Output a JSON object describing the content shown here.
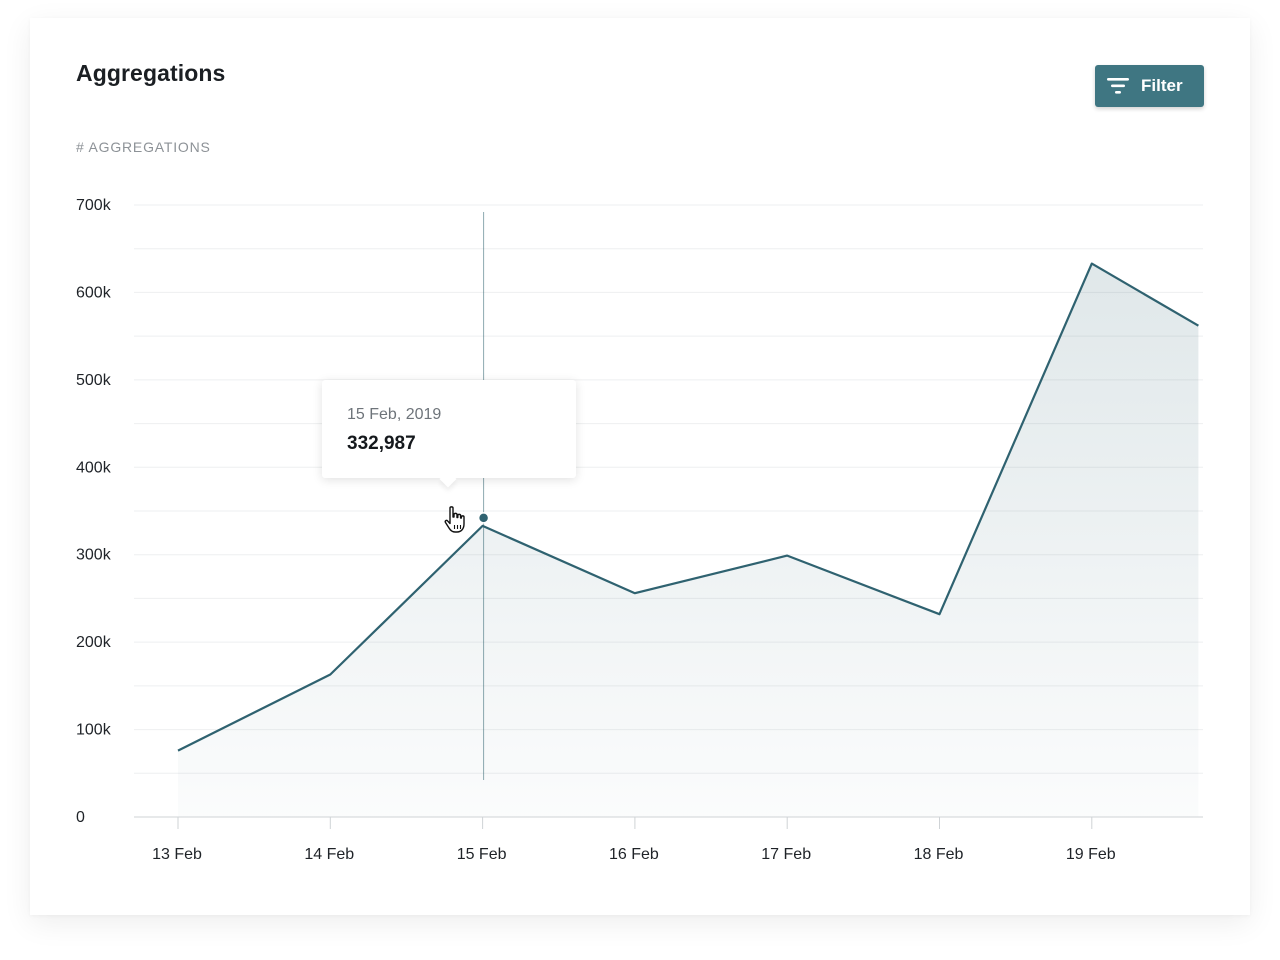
{
  "card": {
    "title": "Aggregations",
    "filter_label": "Filter",
    "filter_icon": "filter-icon"
  },
  "chart_data": {
    "type": "area",
    "ylabel": "# AGGREGATIONS",
    "categories": [
      "13 Feb",
      "14 Feb",
      "15 Feb",
      "16 Feb",
      "17 Feb",
      "18 Feb",
      "19 Feb"
    ],
    "y_tick_labels": [
      "0",
      "100k",
      "200k",
      "300k",
      "400k",
      "500k",
      "600k",
      "700k"
    ],
    "ylim": [
      0,
      700000
    ],
    "values": [
      76000,
      163000,
      332987,
      256000,
      299000,
      232000,
      633000,
      562000
    ],
    "x_index": [
      0,
      1,
      2,
      3,
      4,
      5,
      6,
      6.7
    ],
    "grid": true,
    "line_color": "#2f6270",
    "fill_color": "#2f6270",
    "tooltip": {
      "index": 2,
      "date": "15 Feb, 2019",
      "value": "332,987"
    }
  },
  "colors": {
    "accent": "#3f7682",
    "line": "#2f6270",
    "grid": "#eeeff0"
  }
}
